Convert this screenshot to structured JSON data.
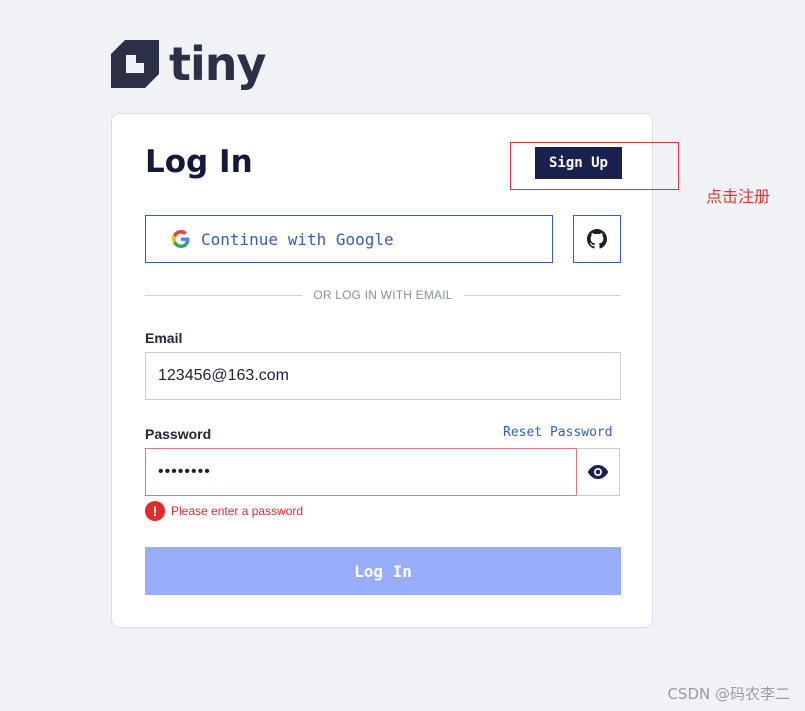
{
  "logo": {
    "text": "tiny"
  },
  "card": {
    "title": "Log In",
    "signup_label": "Sign Up",
    "google_label": "Continue with Google",
    "divider_text": "OR LOG IN WITH EMAIL",
    "email": {
      "label": "Email",
      "value": "123456@163.com"
    },
    "password": {
      "label": "Password",
      "value": "••••••••",
      "reset_label": "Reset Password"
    },
    "error_text": "Please enter a password",
    "login_label": "Log In"
  },
  "annotation": {
    "text": "点击注册",
    "color": "#e23535"
  },
  "watermark": "CSDN @码农李二",
  "colors": {
    "brand_dark": "#1a2150",
    "link_blue": "#335dbb",
    "login_disabled": "#98aefd",
    "error": "#e32b2b"
  },
  "icons": [
    "tiny-logo-icon",
    "google-icon",
    "github-icon",
    "eye-icon",
    "error-icon"
  ]
}
